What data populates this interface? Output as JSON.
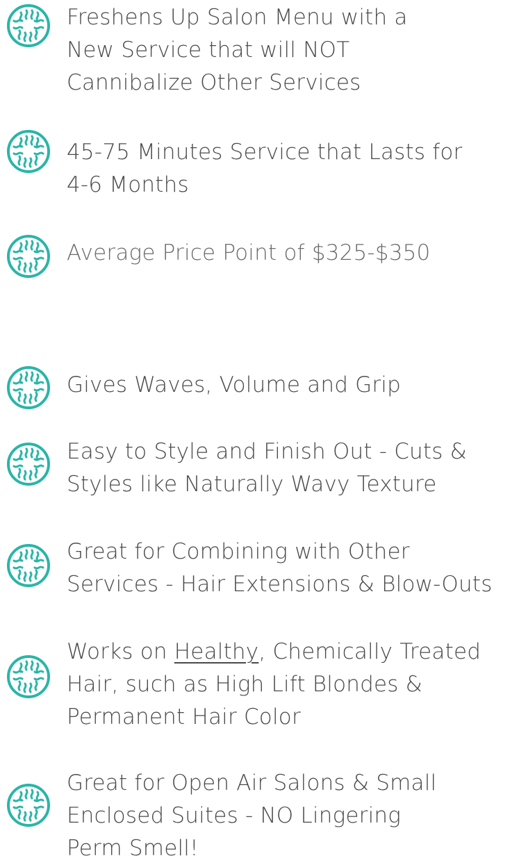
{
  "accent_color": "#2ab5a8",
  "icon_name": "wavy-circle-bullet-icon",
  "items": [
    {
      "lines": [
        "Freshens Up Salon Menu with a",
        "New Service that will NOT",
        "Cannibalize Other Services"
      ]
    },
    {
      "lines": [
        "45-75 Minutes Service that Lasts for",
        "4-6 Months"
      ]
    },
    {
      "lines": [
        "Average Price Point of $325-$350"
      ]
    },
    {
      "lines": [
        "Gives Waves, Volume and Grip"
      ]
    },
    {
      "lines": [
        "Easy to Style and Finish Out - Cuts &",
        "Styles like Naturally Wavy Texture"
      ]
    },
    {
      "lines": [
        "Great for Combining with Other",
        "Services - Hair Extensions & Blow-Outs"
      ]
    },
    {
      "line1_prefix": "Works on ",
      "line1_underlined": "Healthy",
      "line1_suffix": ", Chemically Treated",
      "lines": [
        "Hair, such as High Lift Blondes &",
        "Permanent Hair Color"
      ]
    },
    {
      "lines": [
        "Great for Open Air Salons & Small",
        "Enclosed Suites - NO Lingering",
        "Perm Smell!"
      ]
    }
  ]
}
